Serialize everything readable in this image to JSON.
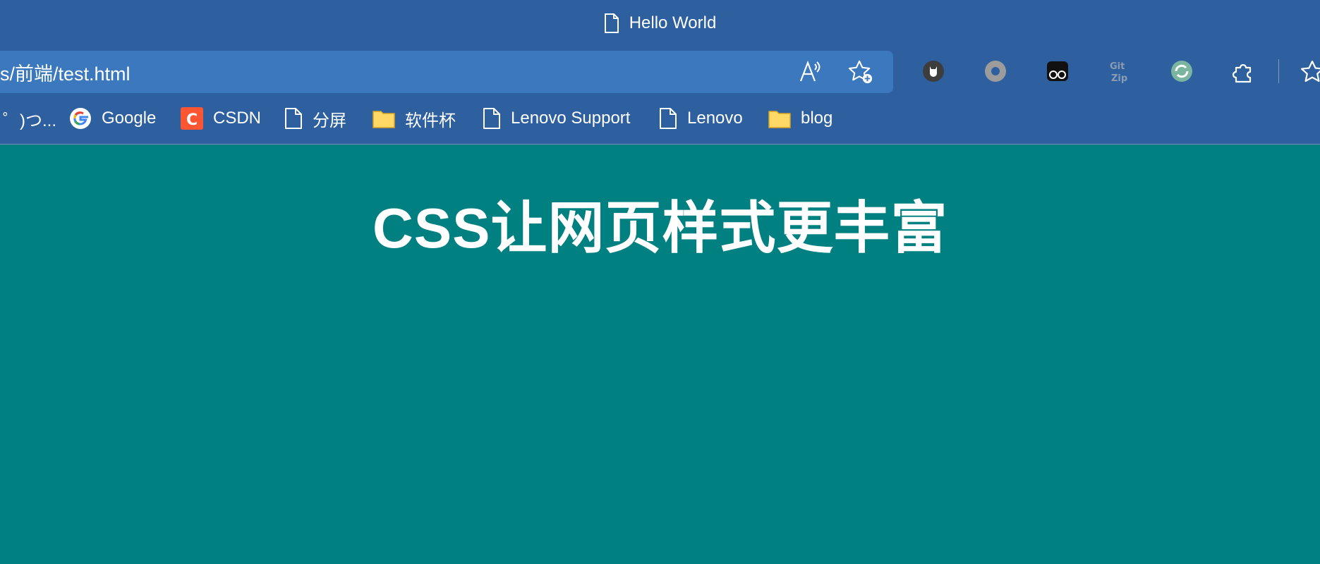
{
  "window": {
    "title": "Hello World",
    "title_icon": "document-icon"
  },
  "address_bar": {
    "url": "s/前端/test.html",
    "read_aloud_icon": "read-aloud-icon",
    "favorite_icon": "add-favorite-icon"
  },
  "extensions": [
    {
      "name": "cat-extension-icon"
    },
    {
      "name": "circle-extension-icon"
    },
    {
      "name": "glasses-extension-icon"
    },
    {
      "name": "gitzip-extension-icon",
      "label": "Git Zip"
    },
    {
      "name": "sync-extension-icon"
    },
    {
      "name": "puzzle-extensions-icon"
    },
    {
      "name": "favorites-icon"
    }
  ],
  "bookmarks": [
    {
      "label": "゜)つ...",
      "icon": "none"
    },
    {
      "label": "Google",
      "icon": "google-icon"
    },
    {
      "label": "CSDN",
      "icon": "csdn-icon"
    },
    {
      "label": "分屏",
      "icon": "document-icon"
    },
    {
      "label": "软件杯",
      "icon": "folder-icon"
    },
    {
      "label": "Lenovo Support",
      "icon": "document-icon"
    },
    {
      "label": "Lenovo",
      "icon": "document-icon"
    },
    {
      "label": "blog",
      "icon": "folder-icon"
    }
  ],
  "page": {
    "heading": "CSS让网页样式更丰富",
    "background": "#008080"
  },
  "colors": {
    "chrome": "#2e5f9f",
    "address_bar": "#3b78bd",
    "heading_text": "#ffffff"
  }
}
